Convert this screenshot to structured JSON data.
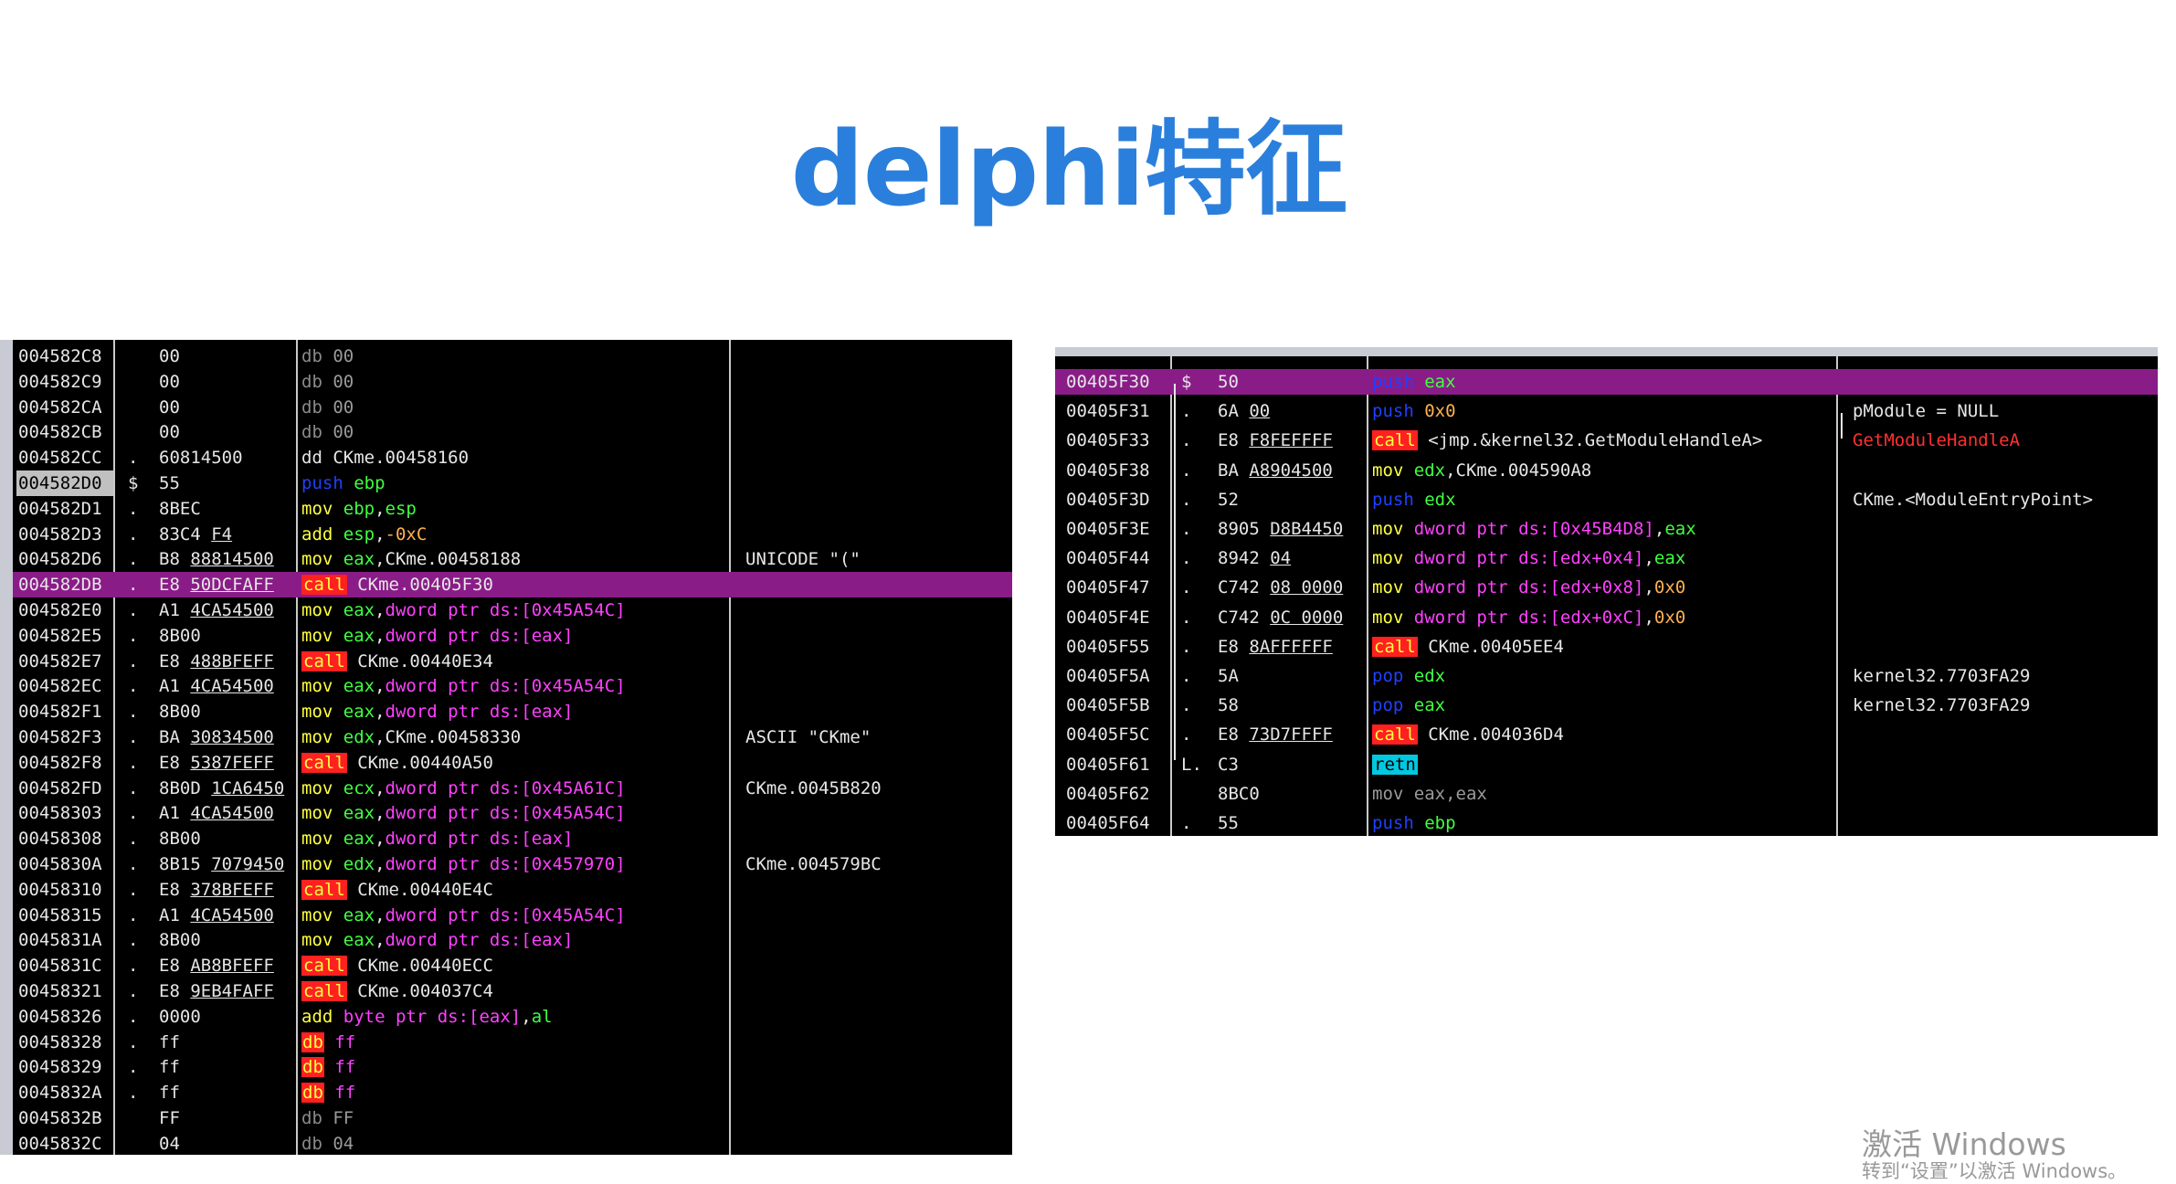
{
  "title": "delphi特征",
  "watermark": {
    "line1": "激活 Windows",
    "line2": "转到“设置”以激活 Windows。"
  },
  "left_panel": {
    "rows": [
      {
        "addr": "004582C8",
        "mark": "",
        "hex": "00",
        "disasm": [
          [
            "kw-db",
            "db "
          ],
          [
            "grey",
            "00"
          ]
        ],
        "comment": ""
      },
      {
        "addr": "004582C9",
        "mark": "",
        "hex": "00",
        "disasm": [
          [
            "kw-db",
            "db "
          ],
          [
            "grey",
            "00"
          ]
        ],
        "comment": ""
      },
      {
        "addr": "004582CA",
        "mark": "",
        "hex": "00",
        "disasm": [
          [
            "kw-db",
            "db "
          ],
          [
            "grey",
            "00"
          ]
        ],
        "comment": ""
      },
      {
        "addr": "004582CB",
        "mark": "",
        "hex": "00",
        "disasm": [
          [
            "kw-db",
            "db "
          ],
          [
            "grey",
            "00"
          ]
        ],
        "comment": ""
      },
      {
        "addr": "004582CC",
        "mark": ".",
        "hex": "60814500",
        "disasm": [
          [
            "white",
            "dd CKme.00458160"
          ]
        ],
        "comment": ""
      },
      {
        "addr": "004582D0",
        "mark": "$",
        "hex": "55",
        "disasm": [
          [
            "kw-push",
            "push "
          ],
          [
            "reg",
            "ebp"
          ]
        ],
        "comment": "",
        "addrsel": true
      },
      {
        "addr": "004582D1",
        "mark": ".",
        "hex": "8BEC",
        "disasm": [
          [
            "kw-mov",
            "mov "
          ],
          [
            "reg",
            "ebp"
          ],
          [
            "white",
            ","
          ],
          [
            "reg",
            "esp"
          ]
        ],
        "comment": ""
      },
      {
        "addr": "004582D3",
        "mark": ".",
        "hex": "83C4 F4",
        "disasm": [
          [
            "kw-add",
            "add "
          ],
          [
            "reg",
            "esp"
          ],
          [
            "white",
            ","
          ],
          [
            "num",
            "-0xC"
          ]
        ],
        "comment": ""
      },
      {
        "addr": "004582D6",
        "mark": ".",
        "hex": "B8 88814500",
        "disasm": [
          [
            "kw-mov",
            "mov "
          ],
          [
            "reg",
            "eax"
          ],
          [
            "white",
            ",CKme.00458188"
          ]
        ],
        "comment": "UNICODE \"(\""
      },
      {
        "addr": "004582DB",
        "mark": ".",
        "hex": "E8 50DCFAFF",
        "disasm": [
          [
            "kw-call",
            "call"
          ],
          [
            "white",
            " CKme.00405F30"
          ]
        ],
        "comment": "",
        "sel": true
      },
      {
        "addr": "004582E0",
        "mark": ".",
        "hex": "A1 4CA54500",
        "disasm": [
          [
            "kw-mov",
            "mov "
          ],
          [
            "reg",
            "eax"
          ],
          [
            "white",
            ","
          ],
          [
            "ptr",
            "dword ptr ds:[0x45A54C]"
          ]
        ],
        "comment": ""
      },
      {
        "addr": "004582E5",
        "mark": ".",
        "hex": "8B00",
        "disasm": [
          [
            "kw-mov",
            "mov "
          ],
          [
            "reg",
            "eax"
          ],
          [
            "white",
            ","
          ],
          [
            "ptr",
            "dword ptr ds:[eax]"
          ]
        ],
        "comment": ""
      },
      {
        "addr": "004582E7",
        "mark": ".",
        "hex": "E8 488BFEFF",
        "disasm": [
          [
            "kw-call",
            "call"
          ],
          [
            "white",
            " CKme.00440E34"
          ]
        ],
        "comment": ""
      },
      {
        "addr": "004582EC",
        "mark": ".",
        "hex": "A1 4CA54500",
        "disasm": [
          [
            "kw-mov",
            "mov "
          ],
          [
            "reg",
            "eax"
          ],
          [
            "white",
            ","
          ],
          [
            "ptr",
            "dword ptr ds:[0x45A54C]"
          ]
        ],
        "comment": ""
      },
      {
        "addr": "004582F1",
        "mark": ".",
        "hex": "8B00",
        "disasm": [
          [
            "kw-mov",
            "mov "
          ],
          [
            "reg",
            "eax"
          ],
          [
            "white",
            ","
          ],
          [
            "ptr",
            "dword ptr ds:[eax]"
          ]
        ],
        "comment": ""
      },
      {
        "addr": "004582F3",
        "mark": ".",
        "hex": "BA 30834500",
        "disasm": [
          [
            "kw-mov",
            "mov "
          ],
          [
            "reg",
            "edx"
          ],
          [
            "white",
            ",CKme.00458330"
          ]
        ],
        "comment": "ASCII \"CKme\""
      },
      {
        "addr": "004582F8",
        "mark": ".",
        "hex": "E8 5387FEFF",
        "disasm": [
          [
            "kw-call",
            "call"
          ],
          [
            "white",
            " CKme.00440A50"
          ]
        ],
        "comment": ""
      },
      {
        "addr": "004582FD",
        "mark": ".",
        "hex": "8B0D 1CA6450",
        "disasm": [
          [
            "kw-mov",
            "mov "
          ],
          [
            "reg",
            "ecx"
          ],
          [
            "white",
            ","
          ],
          [
            "ptr",
            "dword ptr ds:[0x45A61C]"
          ]
        ],
        "comment": "CKme.0045B820"
      },
      {
        "addr": "00458303",
        "mark": ".",
        "hex": "A1 4CA54500",
        "disasm": [
          [
            "kw-mov",
            "mov "
          ],
          [
            "reg",
            "eax"
          ],
          [
            "white",
            ","
          ],
          [
            "ptr",
            "dword ptr ds:[0x45A54C]"
          ]
        ],
        "comment": ""
      },
      {
        "addr": "00458308",
        "mark": ".",
        "hex": "8B00",
        "disasm": [
          [
            "kw-mov",
            "mov "
          ],
          [
            "reg",
            "eax"
          ],
          [
            "white",
            ","
          ],
          [
            "ptr",
            "dword ptr ds:[eax]"
          ]
        ],
        "comment": ""
      },
      {
        "addr": "0045830A",
        "mark": ".",
        "hex": "8B15 7079450",
        "disasm": [
          [
            "kw-mov",
            "mov "
          ],
          [
            "reg",
            "edx"
          ],
          [
            "white",
            ","
          ],
          [
            "ptr",
            "dword ptr ds:[0x457970]"
          ]
        ],
        "comment": "CKme.004579BC"
      },
      {
        "addr": "00458310",
        "mark": ".",
        "hex": "E8 378BFEFF",
        "disasm": [
          [
            "kw-call",
            "call"
          ],
          [
            "white",
            " CKme.00440E4C"
          ]
        ],
        "comment": ""
      },
      {
        "addr": "00458315",
        "mark": ".",
        "hex": "A1 4CA54500",
        "disasm": [
          [
            "kw-mov",
            "mov "
          ],
          [
            "reg",
            "eax"
          ],
          [
            "white",
            ","
          ],
          [
            "ptr",
            "dword ptr ds:[0x45A54C]"
          ]
        ],
        "comment": ""
      },
      {
        "addr": "0045831A",
        "mark": ".",
        "hex": "8B00",
        "disasm": [
          [
            "kw-mov",
            "mov "
          ],
          [
            "reg",
            "eax"
          ],
          [
            "white",
            ","
          ],
          [
            "ptr",
            "dword ptr ds:[eax]"
          ]
        ],
        "comment": ""
      },
      {
        "addr": "0045831C",
        "mark": ".",
        "hex": "E8 AB8BFEFF",
        "disasm": [
          [
            "kw-call",
            "call"
          ],
          [
            "white",
            " CKme.00440ECC"
          ]
        ],
        "comment": ""
      },
      {
        "addr": "00458321",
        "mark": ".",
        "hex": "E8 9EB4FAFF",
        "disasm": [
          [
            "kw-call",
            "call"
          ],
          [
            "white",
            " CKme.004037C4"
          ]
        ],
        "comment": ""
      },
      {
        "addr": "00458326",
        "mark": ".",
        "hex": "0000",
        "disasm": [
          [
            "kw-add",
            "add "
          ],
          [
            "ptr",
            "byte ptr ds:[eax]"
          ],
          [
            "white",
            ","
          ],
          [
            "reg",
            "al"
          ]
        ],
        "comment": ""
      },
      {
        "addr": "00458328",
        "mark": ".",
        "hex": "ff",
        "disasm": [
          [
            "kw-dbred",
            "db"
          ],
          [
            "ptr",
            " ff"
          ]
        ],
        "comment": ""
      },
      {
        "addr": "00458329",
        "mark": ".",
        "hex": "ff",
        "disasm": [
          [
            "kw-dbred",
            "db"
          ],
          [
            "ptr",
            " ff"
          ]
        ],
        "comment": ""
      },
      {
        "addr": "0045832A",
        "mark": ".",
        "hex": "ff",
        "disasm": [
          [
            "kw-dbred",
            "db"
          ],
          [
            "ptr",
            " ff"
          ]
        ],
        "comment": ""
      },
      {
        "addr": "0045832B",
        "mark": "",
        "hex": "FF",
        "disasm": [
          [
            "kw-db",
            "db "
          ],
          [
            "grey",
            "FF"
          ]
        ],
        "comment": ""
      },
      {
        "addr": "0045832C",
        "mark": "",
        "hex": "04",
        "disasm": [
          [
            "kw-db",
            "db "
          ],
          [
            "grey",
            "04"
          ]
        ],
        "comment": ""
      }
    ]
  },
  "right_panel": {
    "rows": [
      {
        "addr": "00405F30",
        "mark": "$",
        "hex": "50",
        "disasm": [
          [
            "kw-push",
            "push "
          ],
          [
            "reg",
            "eax"
          ]
        ],
        "comment": "",
        "sel": true
      },
      {
        "addr": "00405F31",
        "mark": ".",
        "hex": "6A 00",
        "disasm": [
          [
            "kw-push",
            "push "
          ],
          [
            "num",
            "0x0"
          ]
        ],
        "comment": "pModule = NULL"
      },
      {
        "addr": "00405F33",
        "mark": ".",
        "hex": "E8 F8FEFFFF",
        "disasm": [
          [
            "kw-call",
            "call"
          ],
          [
            "white",
            " <jmp.&kernel32.GetModuleHandleA>"
          ]
        ],
        "comment": "GetModuleHandleA",
        "commentRed": true
      },
      {
        "addr": "00405F38",
        "mark": ".",
        "hex": "BA A8904500",
        "disasm": [
          [
            "kw-mov",
            "mov "
          ],
          [
            "reg",
            "edx"
          ],
          [
            "white",
            ",CKme.004590A8"
          ]
        ],
        "comment": ""
      },
      {
        "addr": "00405F3D",
        "mark": ".",
        "hex": "52",
        "disasm": [
          [
            "kw-push",
            "push "
          ],
          [
            "reg",
            "edx"
          ]
        ],
        "comment": "CKme.<ModuleEntryPoint>"
      },
      {
        "addr": "00405F3E",
        "mark": ".",
        "hex": "8905 D8B4450",
        "disasm": [
          [
            "kw-mov",
            "mov "
          ],
          [
            "ptr",
            "dword ptr ds:[0x45B4D8]"
          ],
          [
            "white",
            ","
          ],
          [
            "reg",
            "eax"
          ]
        ],
        "comment": ""
      },
      {
        "addr": "00405F44",
        "mark": ".",
        "hex": "8942 04",
        "disasm": [
          [
            "kw-mov",
            "mov "
          ],
          [
            "ptr",
            "dword ptr ds:[edx+0x4]"
          ],
          [
            "white",
            ","
          ],
          [
            "reg",
            "eax"
          ]
        ],
        "comment": ""
      },
      {
        "addr": "00405F47",
        "mark": ".",
        "hex": "C742 08 0000",
        "disasm": [
          [
            "kw-mov",
            "mov "
          ],
          [
            "ptr",
            "dword ptr ds:[edx+0x8]"
          ],
          [
            "white",
            ","
          ],
          [
            "num",
            "0x0"
          ]
        ],
        "comment": ""
      },
      {
        "addr": "00405F4E",
        "mark": ".",
        "hex": "C742 0C 0000",
        "disasm": [
          [
            "kw-mov",
            "mov "
          ],
          [
            "ptr",
            "dword ptr ds:[edx+0xC]"
          ],
          [
            "white",
            ","
          ],
          [
            "num",
            "0x0"
          ]
        ],
        "comment": ""
      },
      {
        "addr": "00405F55",
        "mark": ".",
        "hex": "E8 8AFFFFFF",
        "disasm": [
          [
            "kw-call",
            "call"
          ],
          [
            "white",
            " CKme.00405EE4"
          ]
        ],
        "comment": ""
      },
      {
        "addr": "00405F5A",
        "mark": ".",
        "hex": "5A",
        "disasm": [
          [
            "kw-push",
            "pop "
          ],
          [
            "reg",
            "edx"
          ]
        ],
        "comment": "kernel32.7703FA29"
      },
      {
        "addr": "00405F5B",
        "mark": ".",
        "hex": "58",
        "disasm": [
          [
            "kw-push",
            "pop "
          ],
          [
            "reg",
            "eax"
          ]
        ],
        "comment": "kernel32.7703FA29"
      },
      {
        "addr": "00405F5C",
        "mark": ".",
        "hex": "E8 73D7FFFF",
        "disasm": [
          [
            "kw-call",
            "call"
          ],
          [
            "white",
            " CKme.004036D4"
          ]
        ],
        "comment": ""
      },
      {
        "addr": "00405F61",
        "mark": "L.",
        "hex": "C3",
        "disasm": [
          [
            "kw-jmp",
            "retn"
          ]
        ],
        "comment": ""
      },
      {
        "addr": "00405F62",
        "mark": "",
        "hex": "8BC0",
        "disasm": [
          [
            "grey",
            "mov eax,eax"
          ]
        ],
        "comment": ""
      },
      {
        "addr": "00405F64",
        "mark": ".",
        "hex": "55",
        "disasm": [
          [
            "kw-push",
            "push "
          ],
          [
            "reg",
            "ebp"
          ]
        ],
        "comment": ""
      }
    ]
  }
}
